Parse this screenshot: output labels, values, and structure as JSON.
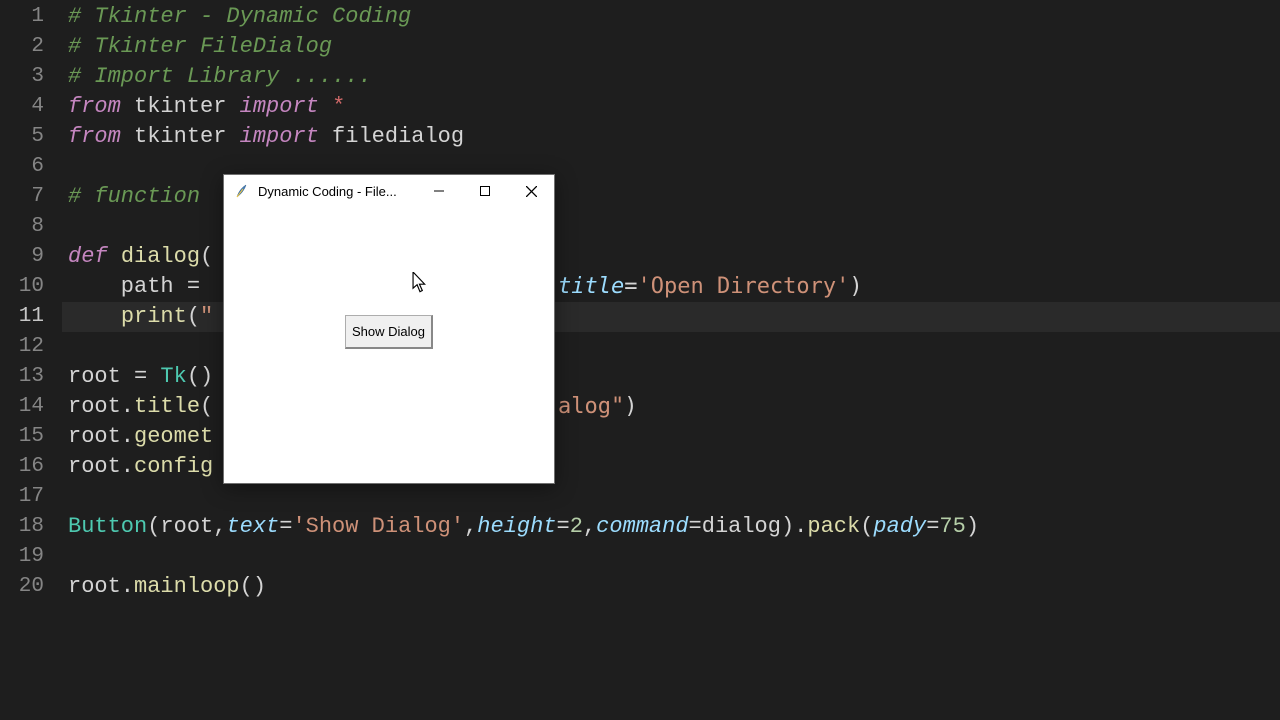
{
  "lines": [
    {
      "n": "1",
      "tokens": [
        {
          "t": "# Tkinter - Dynamic Coding",
          "c": "c-comment"
        }
      ]
    },
    {
      "n": "2",
      "tokens": [
        {
          "t": "# Tkinter FileDialog",
          "c": "c-comment"
        }
      ]
    },
    {
      "n": "3",
      "tokens": [
        {
          "t": "# Import Library ......",
          "c": "c-comment"
        }
      ]
    },
    {
      "n": "4",
      "tokens": [
        {
          "t": "from",
          "c": "c-keyword"
        },
        {
          "t": " tkinter ",
          "c": "c-white"
        },
        {
          "t": "import",
          "c": "c-keyword"
        },
        {
          "t": " ",
          "c": "c-white"
        },
        {
          "t": "*",
          "c": "c-star"
        }
      ]
    },
    {
      "n": "5",
      "tokens": [
        {
          "t": "from",
          "c": "c-keyword"
        },
        {
          "t": " tkinter ",
          "c": "c-white"
        },
        {
          "t": "import",
          "c": "c-keyword"
        },
        {
          "t": " filedialog",
          "c": "c-white"
        }
      ]
    },
    {
      "n": "6",
      "tokens": []
    },
    {
      "n": "7",
      "tokens": [
        {
          "t": "# function",
          "c": "c-comment"
        }
      ]
    },
    {
      "n": "8",
      "tokens": []
    },
    {
      "n": "9",
      "tokens": [
        {
          "t": "def",
          "c": "c-keyword"
        },
        {
          "t": " ",
          "c": "c-white"
        },
        {
          "t": "dialog",
          "c": "c-func"
        },
        {
          "t": "(",
          "c": "c-white"
        }
      ]
    },
    {
      "n": "10",
      "tokens": [
        {
          "t": "    path = ",
          "c": "c-white"
        }
      ]
    },
    {
      "n": "11",
      "tokens": [
        {
          "t": "    ",
          "c": "c-white"
        },
        {
          "t": "print",
          "c": "c-func"
        },
        {
          "t": "(",
          "c": "c-white"
        },
        {
          "t": "\"",
          "c": "c-string"
        }
      ],
      "hl": true
    },
    {
      "n": "12",
      "tokens": []
    },
    {
      "n": "13",
      "tokens": [
        {
          "t": "root = ",
          "c": "c-white"
        },
        {
          "t": "Tk",
          "c": "c-method"
        },
        {
          "t": "()",
          "c": "c-white"
        }
      ]
    },
    {
      "n": "14",
      "tokens": [
        {
          "t": "root.",
          "c": "c-white"
        },
        {
          "t": "title",
          "c": "c-func"
        },
        {
          "t": "(",
          "c": "c-white"
        }
      ]
    },
    {
      "n": "15",
      "tokens": [
        {
          "t": "root.",
          "c": "c-white"
        },
        {
          "t": "geomet",
          "c": "c-func"
        }
      ]
    },
    {
      "n": "16",
      "tokens": [
        {
          "t": "root.",
          "c": "c-white"
        },
        {
          "t": "config",
          "c": "c-func"
        }
      ]
    },
    {
      "n": "17",
      "tokens": []
    },
    {
      "n": "18",
      "tokens": [
        {
          "t": "Button",
          "c": "c-method"
        },
        {
          "t": "(root,",
          "c": "c-white"
        },
        {
          "t": "text",
          "c": "c-param"
        },
        {
          "t": "=",
          "c": "c-white"
        },
        {
          "t": "'Show Dialog'",
          "c": "c-string"
        },
        {
          "t": ",",
          "c": "c-white"
        },
        {
          "t": "height",
          "c": "c-param"
        },
        {
          "t": "=",
          "c": "c-white"
        },
        {
          "t": "2",
          "c": "c-number"
        },
        {
          "t": ",",
          "c": "c-white"
        },
        {
          "t": "command",
          "c": "c-param"
        },
        {
          "t": "=dialog).",
          "c": "c-white"
        },
        {
          "t": "pack",
          "c": "c-func"
        },
        {
          "t": "(",
          "c": "c-white"
        },
        {
          "t": "pady",
          "c": "c-param"
        },
        {
          "t": "=",
          "c": "c-white"
        },
        {
          "t": "75",
          "c": "c-number"
        },
        {
          "t": ")",
          "c": "c-white"
        }
      ]
    },
    {
      "n": "19",
      "tokens": []
    },
    {
      "n": "20",
      "tokens": [
        {
          "t": "root.",
          "c": "c-white"
        },
        {
          "t": "mainloop",
          "c": "c-func"
        },
        {
          "t": "()",
          "c": "c-white"
        }
      ]
    }
  ],
  "right_fragments": {
    "line10_tail": [
      {
        "t": "title",
        "c": "c-param"
      },
      {
        "t": "=",
        "c": "c-white"
      },
      {
        "t": "'Open Directory'",
        "c": "c-string"
      },
      {
        "t": ")",
        "c": "c-white"
      }
    ],
    "line14_tail": [
      {
        "t": "alog\"",
        "c": "c-string"
      },
      {
        "t": ")",
        "c": "c-white"
      }
    ]
  },
  "tk": {
    "title": "Dynamic Coding - File...",
    "button_label": "Show Dialog"
  }
}
